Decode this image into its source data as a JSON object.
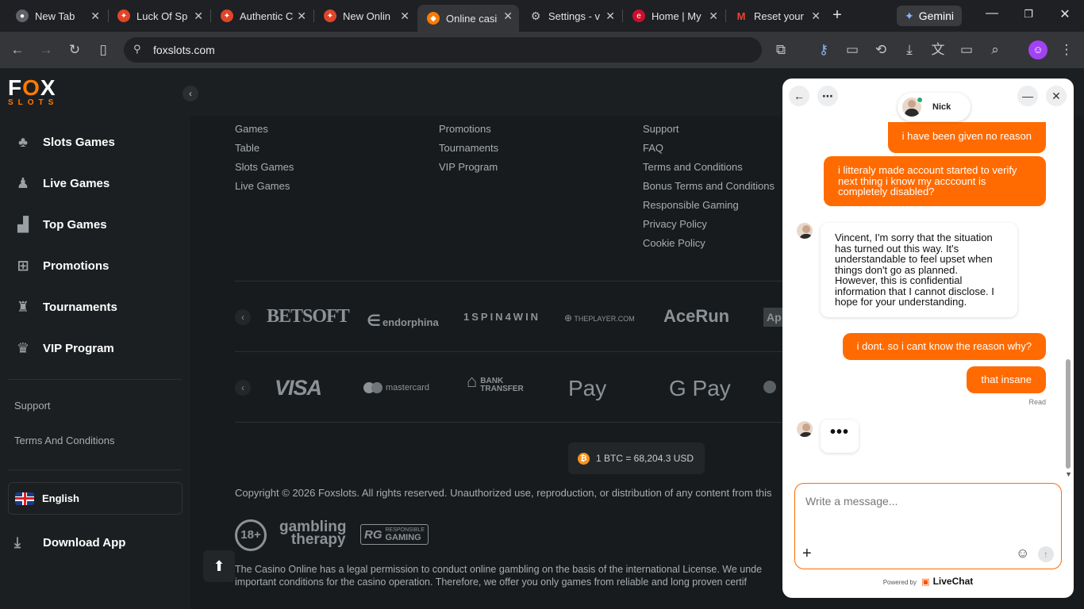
{
  "browser": {
    "tabs": [
      {
        "title": "New Tab",
        "icon": "chrome-icon"
      },
      {
        "title": "Luck Of Sp",
        "icon": "casino-icon"
      },
      {
        "title": "Authentic C",
        "icon": "casino-icon"
      },
      {
        "title": "New Onlin",
        "icon": "casino-icon"
      },
      {
        "title": "Online casi",
        "icon": "foxslots-icon",
        "active": true
      },
      {
        "title": "Settings - v",
        "icon": "gear-icon"
      },
      {
        "title": "Home | My",
        "icon": "site-icon"
      },
      {
        "title": "Reset your",
        "icon": "gmail-icon"
      }
    ],
    "gemini_label": "Gemini",
    "url": "foxslots.com"
  },
  "site": {
    "logo": {
      "line1_a": "F",
      "line1_b": "O",
      "line1_c": "X",
      "line2": "SLOTS"
    },
    "nav": [
      {
        "label": "Slots Games",
        "icon": "slot-machine-icon"
      },
      {
        "label": "Live Games",
        "icon": "dealer-icon"
      },
      {
        "label": "Top Games",
        "icon": "podium-icon"
      },
      {
        "label": "Promotions",
        "icon": "gift-icon"
      },
      {
        "label": "Tournaments",
        "icon": "trophy-icon"
      },
      {
        "label": "VIP Program",
        "icon": "crown-icon"
      }
    ],
    "side_links": [
      "Support",
      "Terms And Conditions"
    ],
    "language": "English",
    "download_label": "Download App",
    "footer_cols": [
      [
        "Games",
        "Table",
        "Slots Games",
        "Live Games"
      ],
      [
        "Promotions",
        "Tournaments",
        "VIP Program"
      ],
      [
        "Support",
        "FAQ",
        "Terms and Conditions",
        "Bonus Terms and Conditions",
        "Responsible Gaming",
        "Privacy Policy",
        "Cookie Policy"
      ]
    ],
    "providers": [
      "BETSOFT",
      "endorphina",
      "1SPIN4WIN",
      "THEPLAYER.COM",
      "AceRun",
      "Ap"
    ],
    "payments": [
      "VISA",
      "mastercard",
      "BANK TRANSFER",
      "Pay",
      "G Pay"
    ],
    "btc_rate": "1 BTC  =  68,204.3 USD",
    "copyright": "Copyright © 2026 Foxslots. All rights reserved. Unauthorized use, reproduction, or distribution of any content from this",
    "badges": {
      "age": "18+",
      "gt_line1": "gambling",
      "gt_line2": "therapy",
      "rg_small": "RESPONSIBLE",
      "rg_big": "GAMING",
      "rg_mono": "RG"
    },
    "legal_line1": "The Casino Online has a legal permission to conduct online gambling on the basis of the international License. We unde",
    "legal_line2": "important conditions for the casino operation. Therefore, we offer you only games from reliable and long proven certif"
  },
  "chat": {
    "agent_name": "Nick",
    "messages": [
      {
        "from": "me",
        "text": "i have been given no reason"
      },
      {
        "from": "me",
        "text": "i litteraly made account started to verify next thing i know my acccount is completely disabled?"
      },
      {
        "from": "agent",
        "text": "Vincent, I'm sorry that the situation has turned out this way. It's understandable to feel upset when things don't go as planned. However, this is confidential information that I cannot disclose. I hope for your understanding."
      },
      {
        "from": "me",
        "text": "i dont. so i cant know the reason why?"
      },
      {
        "from": "me",
        "text": "that insane"
      }
    ],
    "read_label": "Read",
    "typing": "•••",
    "placeholder": "Write a message...",
    "powered_by": "Powered by",
    "brand": "LiveChat"
  },
  "colors": {
    "accent": "#ff6b00",
    "bg": "#181b1d",
    "sidebar": "#1c1f21"
  }
}
